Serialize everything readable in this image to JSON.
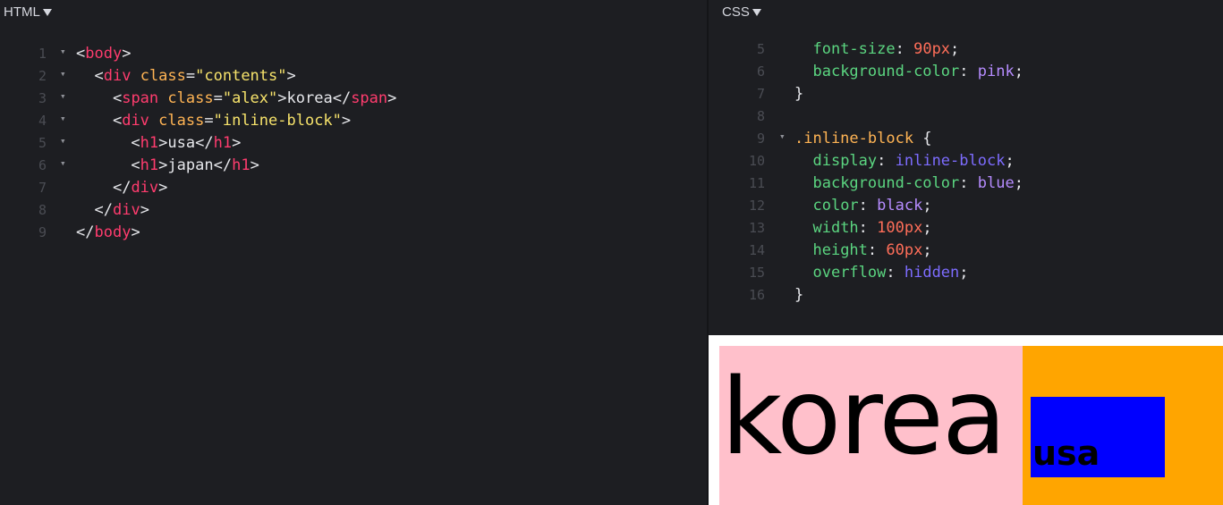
{
  "html_pane": {
    "header": "HTML",
    "lines": [
      {
        "n": "1",
        "fold": true,
        "indent": 0,
        "tokens": [
          [
            "<",
            "t-punct"
          ],
          [
            "body",
            "t-tag"
          ],
          [
            ">",
            "t-punct"
          ]
        ]
      },
      {
        "n": "2",
        "fold": true,
        "indent": 1,
        "tokens": [
          [
            "<",
            "t-punct"
          ],
          [
            "div",
            "t-tag"
          ],
          [
            " ",
            "t-text"
          ],
          [
            "class",
            "t-attr"
          ],
          [
            "=",
            "t-punct"
          ],
          [
            "\"contents\"",
            "t-str"
          ],
          [
            ">",
            "t-punct"
          ]
        ]
      },
      {
        "n": "3",
        "fold": true,
        "indent": 2,
        "tokens": [
          [
            "<",
            "t-punct"
          ],
          [
            "span",
            "t-tag"
          ],
          [
            " ",
            "t-text"
          ],
          [
            "class",
            "t-attr"
          ],
          [
            "=",
            "t-punct"
          ],
          [
            "\"alex\"",
            "t-str"
          ],
          [
            ">",
            "t-punct"
          ],
          [
            "korea",
            "t-text"
          ],
          [
            "</",
            "t-punct"
          ],
          [
            "span",
            "t-tag"
          ],
          [
            ">",
            "t-punct"
          ]
        ]
      },
      {
        "n": "4",
        "fold": true,
        "indent": 2,
        "tokens": [
          [
            "<",
            "t-punct"
          ],
          [
            "div",
            "t-tag"
          ],
          [
            " ",
            "t-text"
          ],
          [
            "class",
            "t-attr"
          ],
          [
            "=",
            "t-punct"
          ],
          [
            "\"inline-block\"",
            "t-str"
          ],
          [
            ">",
            "t-punct"
          ]
        ]
      },
      {
        "n": "5",
        "fold": true,
        "indent": 3,
        "tokens": [
          [
            "<",
            "t-punct"
          ],
          [
            "h1",
            "t-tag"
          ],
          [
            ">",
            "t-punct"
          ],
          [
            "usa",
            "t-text"
          ],
          [
            "</",
            "t-punct"
          ],
          [
            "h1",
            "t-tag"
          ],
          [
            ">",
            "t-punct"
          ]
        ]
      },
      {
        "n": "6",
        "fold": true,
        "indent": 3,
        "tokens": [
          [
            "<",
            "t-punct"
          ],
          [
            "h1",
            "t-tag"
          ],
          [
            ">",
            "t-punct"
          ],
          [
            "japan",
            "t-text"
          ],
          [
            "</",
            "t-punct"
          ],
          [
            "h1",
            "t-tag"
          ],
          [
            ">",
            "t-punct"
          ]
        ]
      },
      {
        "n": "7",
        "fold": false,
        "indent": 2,
        "tokens": [
          [
            "</",
            "t-punct"
          ],
          [
            "div",
            "t-tag"
          ],
          [
            ">",
            "t-punct"
          ]
        ]
      },
      {
        "n": "8",
        "fold": false,
        "indent": 1,
        "tokens": [
          [
            "</",
            "t-punct"
          ],
          [
            "div",
            "t-tag"
          ],
          [
            ">",
            "t-punct"
          ]
        ]
      },
      {
        "n": "9",
        "fold": false,
        "indent": 0,
        "tokens": [
          [
            "</",
            "t-punct"
          ],
          [
            "body",
            "t-tag"
          ],
          [
            ">",
            "t-punct"
          ]
        ]
      }
    ]
  },
  "css_pane": {
    "header": "CSS",
    "lines": [
      {
        "n": "5",
        "fold": false,
        "indent": 1,
        "tokens": [
          [
            "font-size",
            "t-prop"
          ],
          [
            ": ",
            "t-punct"
          ],
          [
            "90px",
            "t-num"
          ],
          [
            ";",
            "t-punct"
          ]
        ]
      },
      {
        "n": "6",
        "fold": false,
        "indent": 1,
        "tokens": [
          [
            "background-color",
            "t-prop"
          ],
          [
            ": ",
            "t-punct"
          ],
          [
            "pink",
            "t-kw"
          ],
          [
            ";",
            "t-punct"
          ]
        ]
      },
      {
        "n": "7",
        "fold": false,
        "indent": 0,
        "tokens": [
          [
            "}",
            "t-punct"
          ]
        ]
      },
      {
        "n": "8",
        "fold": false,
        "indent": 0,
        "tokens": []
      },
      {
        "n": "9",
        "fold": true,
        "indent": 0,
        "tokens": [
          [
            ".inline-block",
            "t-sel"
          ],
          [
            " {",
            "t-punct"
          ]
        ]
      },
      {
        "n": "10",
        "fold": false,
        "indent": 1,
        "tokens": [
          [
            "display",
            "t-prop"
          ],
          [
            ": ",
            "t-punct"
          ],
          [
            "inline-block",
            "t-kw2"
          ],
          [
            ";",
            "t-punct"
          ]
        ]
      },
      {
        "n": "11",
        "fold": false,
        "indent": 1,
        "tokens": [
          [
            "background-color",
            "t-prop"
          ],
          [
            ": ",
            "t-punct"
          ],
          [
            "blue",
            "t-kw"
          ],
          [
            ";",
            "t-punct"
          ]
        ]
      },
      {
        "n": "12",
        "fold": false,
        "indent": 1,
        "tokens": [
          [
            "color",
            "t-prop"
          ],
          [
            ": ",
            "t-punct"
          ],
          [
            "black",
            "t-kw"
          ],
          [
            ";",
            "t-punct"
          ]
        ]
      },
      {
        "n": "13",
        "fold": false,
        "indent": 1,
        "tokens": [
          [
            "width",
            "t-prop"
          ],
          [
            ": ",
            "t-punct"
          ],
          [
            "100px",
            "t-num"
          ],
          [
            ";",
            "t-punct"
          ]
        ]
      },
      {
        "n": "14",
        "fold": false,
        "indent": 1,
        "tokens": [
          [
            "height",
            "t-prop"
          ],
          [
            ": ",
            "t-punct"
          ],
          [
            "60px",
            "t-num"
          ],
          [
            ";",
            "t-punct"
          ]
        ]
      },
      {
        "n": "15",
        "fold": false,
        "indent": 1,
        "tokens": [
          [
            "overflow",
            "t-prop"
          ],
          [
            ": ",
            "t-punct"
          ],
          [
            "hidden",
            "t-kw2"
          ],
          [
            ";",
            "t-punct"
          ]
        ]
      },
      {
        "n": "16",
        "fold": false,
        "indent": 0,
        "tokens": [
          [
            "}",
            "t-punct"
          ]
        ]
      }
    ]
  },
  "preview": {
    "alex_text": "korea",
    "inline_text": "usa",
    "colors": {
      "pink": "#ffc0cb",
      "orange": "#ffa500",
      "blue": "#0000ff",
      "white": "#ffffff"
    }
  },
  "icons": {
    "fold": "triangle-down-icon",
    "header_caret": "caret-down-icon"
  }
}
